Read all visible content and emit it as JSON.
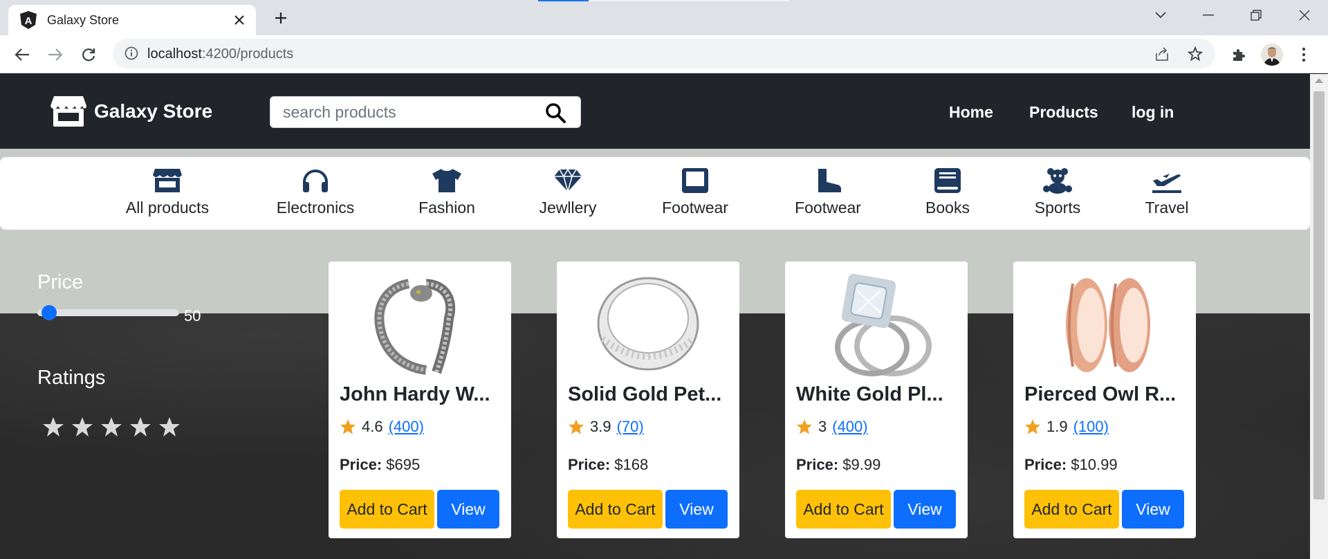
{
  "browser": {
    "tab_title": "Galaxy Store",
    "url_host": "localhost",
    "url_path": ":4200/products"
  },
  "header": {
    "brand": "Galaxy Store",
    "search_placeholder": "search products",
    "nav": [
      "Home",
      "Products",
      "log in"
    ]
  },
  "categories": [
    {
      "label": "All products",
      "icon": "store-icon"
    },
    {
      "label": "Electronics",
      "icon": "headphones-icon"
    },
    {
      "label": "Fashion",
      "icon": "tshirt-icon"
    },
    {
      "label": "Jewllery",
      "icon": "gem-icon"
    },
    {
      "label": "Footwear",
      "icon": "tablet-icon"
    },
    {
      "label": "Footwear",
      "icon": "boot-icon"
    },
    {
      "label": "Books",
      "icon": "book-icon"
    },
    {
      "label": "Sports",
      "icon": "teddy-bear-icon"
    },
    {
      "label": "Travel",
      "icon": "plane-icon"
    }
  ],
  "filters": {
    "price_title": "Price",
    "price_value": "50",
    "ratings_title": "Ratings",
    "stars_total": 5
  },
  "products": [
    {
      "name": "John Hardy W...",
      "rating": "4.6",
      "count": "(400)",
      "price_label": "Price:",
      "price": "$695",
      "cart_label": "Add to Cart",
      "view_label": "View",
      "image": "bracelet"
    },
    {
      "name": "Solid Gold Pet...",
      "rating": "3.9",
      "count": "(70)",
      "price_label": "Price:",
      "price": "$168",
      "cart_label": "Add to Cart",
      "view_label": "View",
      "image": "silver-ring"
    },
    {
      "name": "White Gold Pl...",
      "rating": "3",
      "count": "(400)",
      "price_label": "Price:",
      "price": "$9.99",
      "cart_label": "Add to Cart",
      "view_label": "View",
      "image": "diamond-ring"
    },
    {
      "name": "Pierced Owl R...",
      "rating": "1.9",
      "count": "(100)",
      "price_label": "Price:",
      "price": "$10.99",
      "cart_label": "Add to Cart",
      "view_label": "View",
      "image": "rose-gold-plugs"
    }
  ],
  "colors": {
    "navbar": "#212529",
    "primary": "#0d6efd",
    "warning": "#ffc107",
    "star": "#f0a020"
  }
}
